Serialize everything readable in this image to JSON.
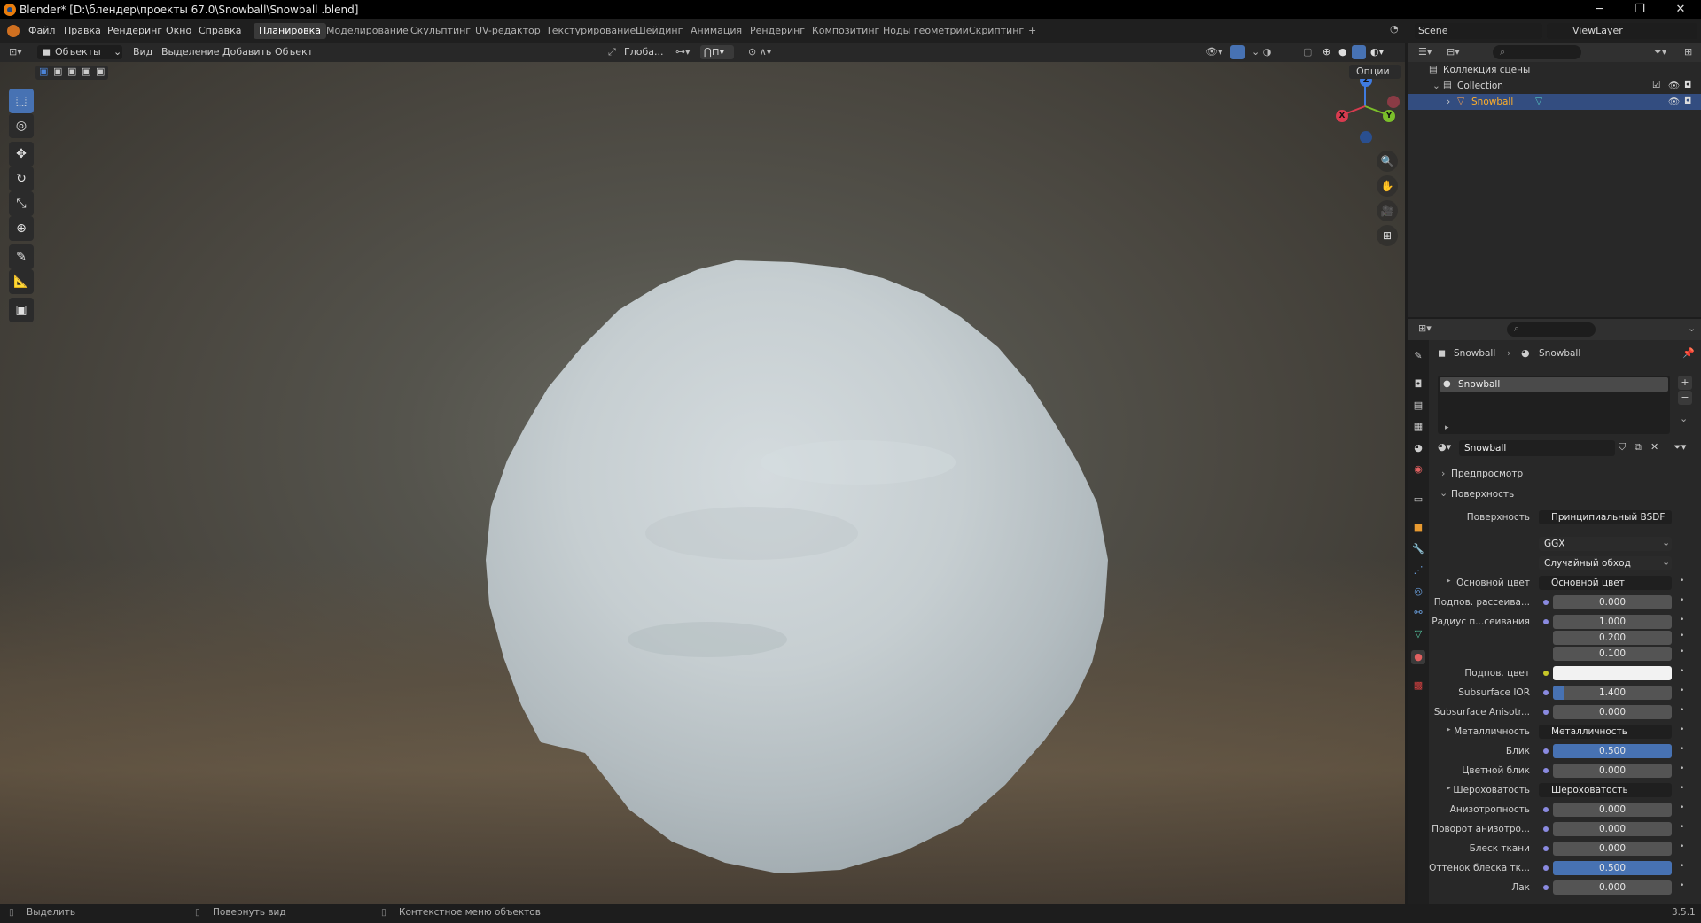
{
  "window": {
    "title": "Blender* [D:\\блендер\\проекты 67.0\\Snowball\\Snowball .blend]",
    "minimize": "─",
    "restore": "❐",
    "close": "✕"
  },
  "menu": {
    "items": [
      "Файл",
      "Правка",
      "Рендеринг",
      "Окно",
      "Справка"
    ],
    "workspaces": [
      "Планировка",
      "Моделирование",
      "Скульптинг",
      "UV-редактор",
      "Текстурирование",
      "Шейдинг",
      "Анимация",
      "Рендеринг",
      "Композитинг",
      "Ноды геометрии",
      "Скриптинг"
    ],
    "active_workspace": "Планировка",
    "add_tab": "+",
    "scene": "Scene",
    "view_layer": "ViewLayer"
  },
  "viewport_header": {
    "mode": "Объекты",
    "menus": [
      "Вид",
      "Выделение",
      "Добавить",
      "Объект"
    ],
    "orientation": "Глоба...",
    "options": "Опции"
  },
  "toolbar": {
    "tools": [
      "select-box",
      "cursor",
      "move",
      "rotate",
      "scale",
      "transform",
      "annotate",
      "measure",
      "add-cube"
    ],
    "active": "select-box"
  },
  "gizmo": {
    "x": "X",
    "y": "Y",
    "z": "Z"
  },
  "outliner": {
    "rows": [
      {
        "label": "Коллекция сцены",
        "level": 0
      },
      {
        "label": "Collection",
        "level": 1
      },
      {
        "label": "Snowball",
        "level": 2,
        "selected": true
      }
    ]
  },
  "properties": {
    "breadcrumb": [
      "Snowball",
      "Snowball"
    ],
    "material_slot": "Snowball",
    "material_name": "Snowball",
    "sections": {
      "preview": "Предпросмотр",
      "surface": "Поверхность"
    },
    "surface_label": "Поверхность",
    "surface_value": "Принципиальный BSDF",
    "distribution": "GGX",
    "subsurface_method": "Случайный обход",
    "rows": [
      {
        "label": "Основной цвет",
        "value": "Основной цвет",
        "type": "link"
      },
      {
        "label": "Подпов. рассеива...",
        "value": "0.000",
        "type": "num"
      },
      {
        "label": "Радиус п...сеивания",
        "value": "1.000",
        "type": "num"
      },
      {
        "label": "",
        "value": "0.200",
        "type": "num"
      },
      {
        "label": "",
        "value": "0.100",
        "type": "num"
      },
      {
        "label": "Подпов. цвет",
        "value": "",
        "type": "color"
      },
      {
        "label": "Subsurface IOR",
        "value": "1.400",
        "type": "num",
        "fill": 0.1
      },
      {
        "label": "Subsurface Anisotr...",
        "value": "0.000",
        "type": "num"
      },
      {
        "label": "Металличность",
        "value": "Металличность",
        "type": "link"
      },
      {
        "label": "Блик",
        "value": "0.500",
        "type": "num",
        "fill": 1
      },
      {
        "label": "Цветной блик",
        "value": "0.000",
        "type": "num"
      },
      {
        "label": "Шероховатость",
        "value": "Шероховатость",
        "type": "link"
      },
      {
        "label": "Анизотропность",
        "value": "0.000",
        "type": "num"
      },
      {
        "label": "Поворот анизотро...",
        "value": "0.000",
        "type": "num"
      },
      {
        "label": "Блеск ткани",
        "value": "0.000",
        "type": "num"
      },
      {
        "label": "Оттенок блеска тк...",
        "value": "0.500",
        "type": "num",
        "fill": 1
      },
      {
        "label": "Лак",
        "value": "0.000",
        "type": "num"
      }
    ]
  },
  "statusbar": {
    "items": [
      "Выделить",
      "Повернуть вид",
      "Контекстное меню объектов"
    ],
    "version": "3.5.1"
  },
  "colors": {
    "accent": "#4772b3",
    "selected_row": "#334d80",
    "snow": "#c9d1d4"
  }
}
